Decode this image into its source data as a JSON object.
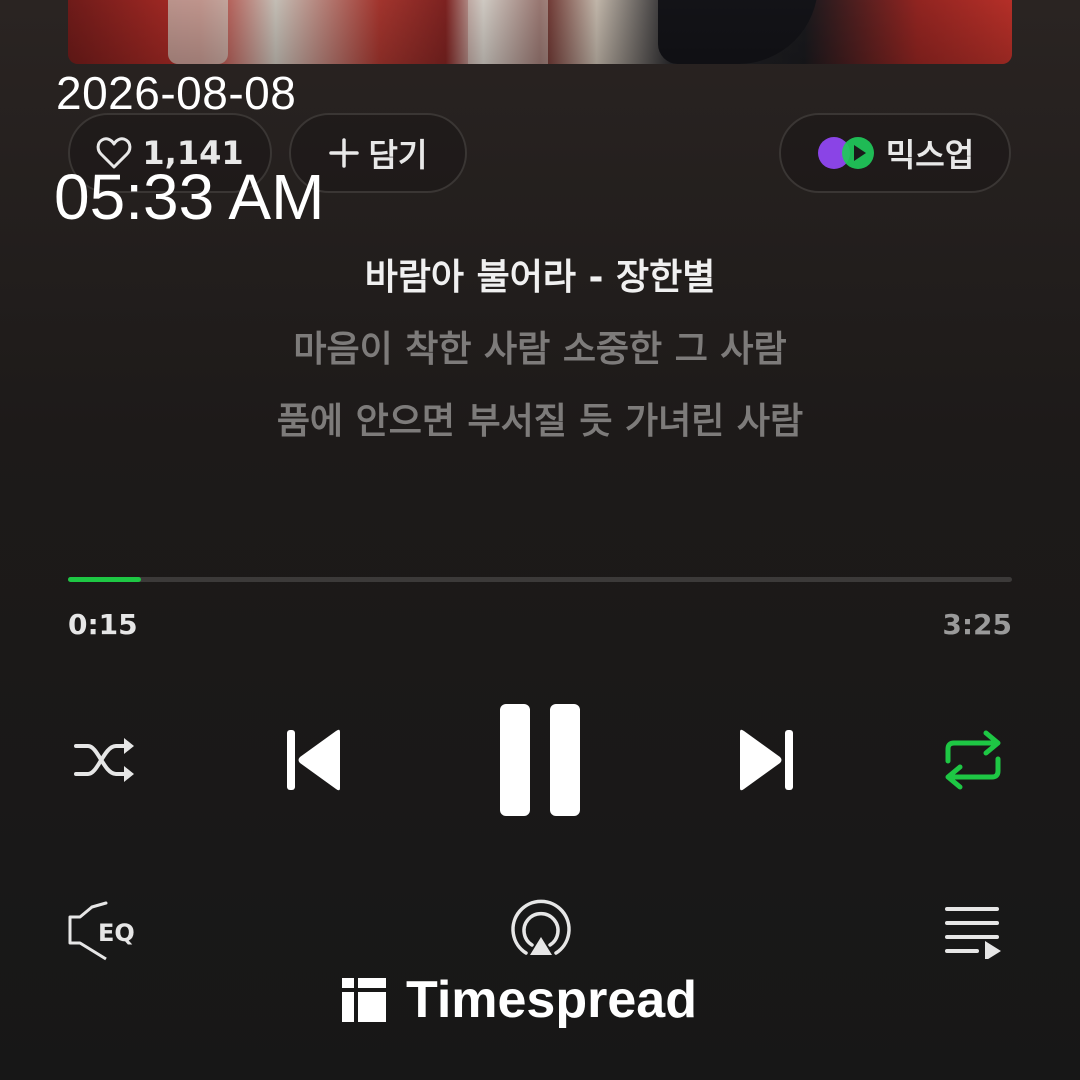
{
  "overlay": {
    "date": "2026-08-08",
    "time": "05:33 AM"
  },
  "actions": {
    "like_count": "1,141",
    "add_label": "담기",
    "mixup_label": "믹스업"
  },
  "song": {
    "title_line": "바람아 불어라 - 장한별",
    "lyric_1": "마음이 착한 사람 소중한 그 사람",
    "lyric_2": "품에 안으면 부서질 듯 가녀린 사람"
  },
  "playback": {
    "current_time": "0:15",
    "total_time": "3:25",
    "progress_fraction": 0.077,
    "state": "playing",
    "repeat": "on"
  },
  "controls": {
    "eq_label": "EQ"
  },
  "icons": {
    "like": "heart-outline-icon",
    "add": "plus-icon",
    "mixup": "mixup-logo-icon",
    "shuffle": "shuffle-icon",
    "prev": "skip-previous-icon",
    "pause": "pause-icon",
    "next": "skip-next-icon",
    "repeat": "repeat-icon",
    "eq": "equalizer-icon",
    "cast": "airplay-icon",
    "queue": "playlist-icon"
  },
  "colors": {
    "accent_green": "#1ec744",
    "background": "#1a1a1a",
    "lyric_gray": "#7d7b7a"
  },
  "watermark": {
    "brand": "Timespread"
  }
}
